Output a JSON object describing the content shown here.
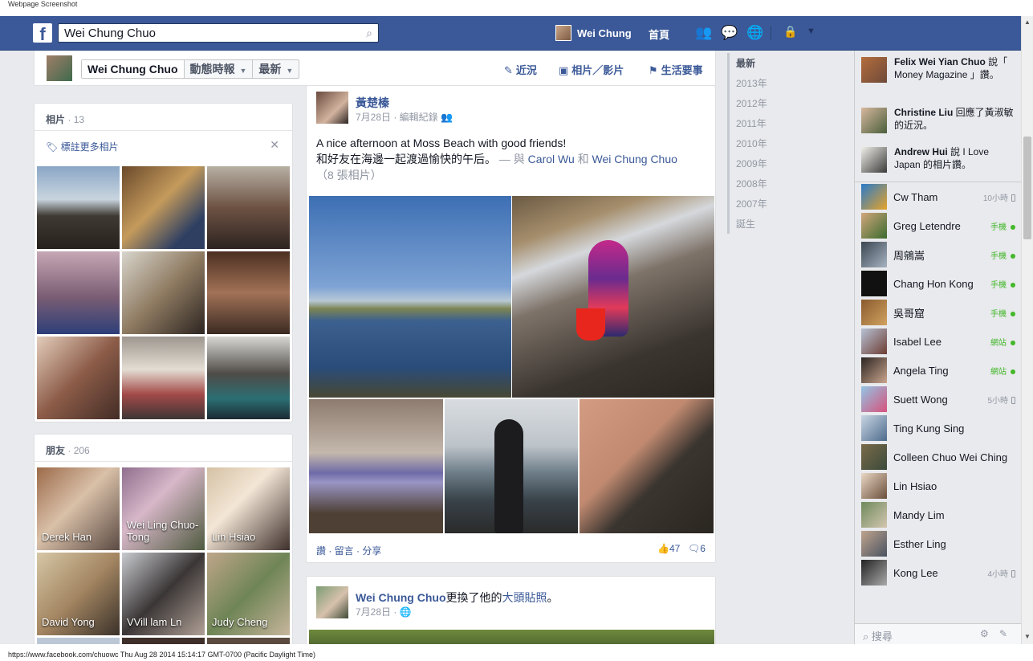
{
  "capture_label": "Webpage Screenshot",
  "footer_url": "https://www.facebook.com/chuowc Thu Aug 28 2014 15:14:17 GMT-0700 (Pacific Daylight Time)",
  "topbar": {
    "logo": "f",
    "search_value": "Wei Chung Chuo",
    "user_name": "Wei Chung",
    "home_label": "首頁"
  },
  "timeline_header": {
    "name_button": "Wei Chung Chuo",
    "activity_dropdown": "動態時報",
    "sort_dropdown": "最新",
    "links": [
      "近況",
      "相片／影片",
      "生活要事"
    ]
  },
  "photos_card": {
    "title": "相片",
    "count": "· 13",
    "tag_more": "標註更多相片"
  },
  "friends_card": {
    "title": "朋友",
    "count": "· 206",
    "friends": [
      "Derek Han",
      "Wei Ling Chuo-Tong",
      "Lin Hsiao",
      "David Yong",
      "VVill lam Ln",
      "Judy Cheng"
    ]
  },
  "post1": {
    "author": "黃楚榛",
    "meta": "7月28日 · 編輯紀錄",
    "text_line1": "A nice afternoon at Moss Beach with good friends!",
    "text_line2": "和好友在海邊一起渡過愉快的午后。",
    "with_prefix": "— 與",
    "mention1": "Carol Wu",
    "and": "和",
    "mention2": "Wei Chung Chuo",
    "photo_count": "（8 張相片）",
    "actions": "讚 · 留言 · 分享",
    "likes": "47",
    "comments": "6"
  },
  "post2": {
    "author": "Wei Chung Chuo",
    "action_text": "更換了他的",
    "action_link": "大頭貼照",
    "action_end": "。",
    "meta": "7月28日 ·"
  },
  "years": [
    "最新",
    "2013年",
    "2012年",
    "2011年",
    "2010年",
    "2009年",
    "2008年",
    "2007年",
    "誕生"
  ],
  "ticker": [
    {
      "name": "Felix Wei Yian Chuo",
      "text": " 說「 Money Magazine 」讚。"
    },
    {
      "name": "Christine Liu",
      "text": " 回應了黃淑敏的近況。"
    },
    {
      "name": "Andrew Hui",
      "text": " 說 I Love Japan 的相片讚。"
    }
  ],
  "chat_friends": [
    {
      "name": "Cw Tham",
      "status": "10小時",
      "type": "time"
    },
    {
      "name": "Greg Letendre",
      "status": "手機",
      "type": "online"
    },
    {
      "name": "周鵷嵩",
      "status": "手機",
      "type": "online"
    },
    {
      "name": "Chang Hon Kong",
      "status": "手機",
      "type": "online"
    },
    {
      "name": "吳哥窟",
      "status": "手機",
      "type": "online"
    },
    {
      "name": "Isabel Lee",
      "status": "網站",
      "type": "online"
    },
    {
      "name": "Angela Ting",
      "status": "網站",
      "type": "online"
    },
    {
      "name": "Suett Wong",
      "status": "5小時",
      "type": "time"
    },
    {
      "name": "Ting Kung Sing",
      "status": "",
      "type": "none"
    },
    {
      "name": "Colleen Chuo Wei Ching",
      "status": "",
      "type": "none"
    },
    {
      "name": "Lin Hsiao",
      "status": "",
      "type": "none"
    },
    {
      "name": "Mandy Lim",
      "status": "",
      "type": "none"
    },
    {
      "name": "Esther Ling",
      "status": "",
      "type": "none"
    },
    {
      "name": "Kong Lee",
      "status": "4小時",
      "type": "time"
    }
  ],
  "chat_search_placeholder": "搜尋"
}
